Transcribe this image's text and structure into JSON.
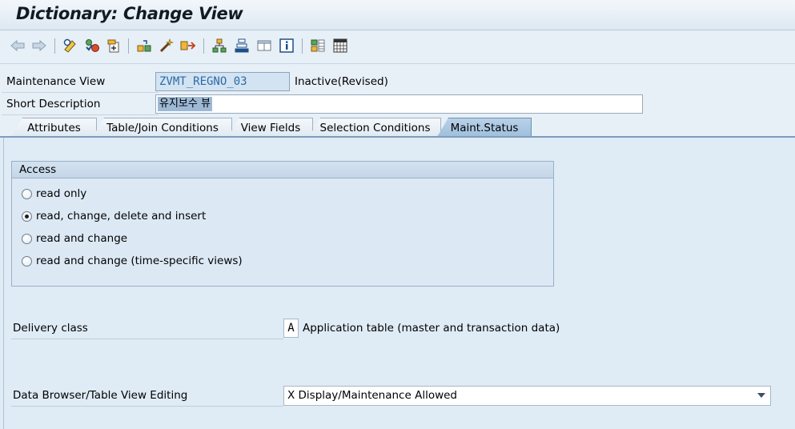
{
  "window": {
    "title": "Dictionary: Change View"
  },
  "toolbar": {
    "buttons": [
      {
        "icon": "back-arrow-icon"
      },
      {
        "icon": "forward-arrow-icon"
      },
      {
        "icon": "display-change-icon"
      },
      {
        "icon": "check-icon"
      },
      {
        "icon": "activate-icon"
      },
      {
        "icon": "other-object-icon"
      },
      {
        "icon": "where-used-icon"
      },
      {
        "icon": "navigate-icon"
      },
      {
        "icon": "hierarchy-icon"
      },
      {
        "icon": "stack-icon"
      },
      {
        "icon": "layout-icon"
      },
      {
        "icon": "info-icon"
      },
      {
        "icon": "tech-settings-icon"
      },
      {
        "icon": "table-icon"
      }
    ]
  },
  "header": {
    "maintenance_view_label": "Maintenance View",
    "maintenance_view_value": "ZVMT_REGNO_03",
    "status": "Inactive(Revised)",
    "short_description_label": "Short Description",
    "short_description_value": "유지보수 뷰"
  },
  "tabs": [
    {
      "label": "Attributes",
      "active": false
    },
    {
      "label": "Table/Join Conditions",
      "active": false
    },
    {
      "label": "View Fields",
      "active": false
    },
    {
      "label": "Selection Conditions",
      "active": false
    },
    {
      "label": "Maint.Status",
      "active": true
    }
  ],
  "access": {
    "title": "Access",
    "options": [
      {
        "label": "read only",
        "checked": false
      },
      {
        "label": "read, change, delete and insert",
        "checked": true
      },
      {
        "label": "read and change",
        "checked": false
      },
      {
        "label": "read and change (time-specific views)",
        "checked": false
      }
    ]
  },
  "delivery": {
    "label": "Delivery class",
    "value": "A",
    "description": "Application table (master and transaction data)"
  },
  "data_browser": {
    "label": "Data Browser/Table View Editing",
    "selected": "X Display/Maintenance Allowed"
  },
  "colors": {
    "accent": "#9fbfdc",
    "background": "#dfebf5",
    "title": "#121a24"
  }
}
